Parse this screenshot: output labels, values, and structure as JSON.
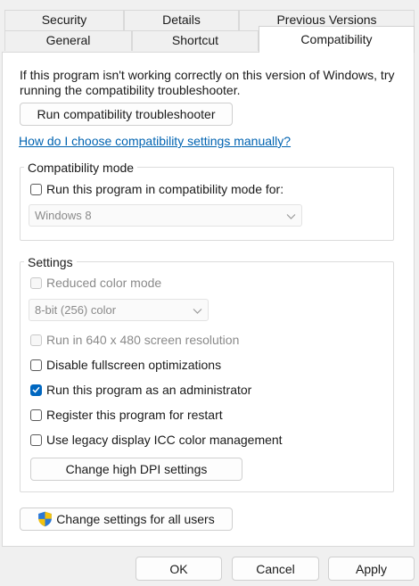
{
  "tabs": {
    "row1": [
      "Security",
      "Details",
      "Previous Versions"
    ],
    "row2": [
      "General",
      "Shortcut",
      "Compatibility"
    ],
    "active": "Compatibility"
  },
  "intro": {
    "line1": "If this program isn't working correctly on this version of Windows, try",
    "line2": "running the compatibility troubleshooter."
  },
  "troubleshooter_button": "Run compatibility troubleshooter",
  "manual_link": "How do I choose compatibility settings manually?",
  "compat_mode": {
    "title": "Compatibility mode",
    "checkbox_label": "Run this program in compatibility mode for:",
    "checked": false,
    "selected_os": "Windows 8"
  },
  "settings": {
    "title": "Settings",
    "reduced_color": {
      "label": "Reduced color mode",
      "checked": false,
      "disabled": true
    },
    "color_depth": "8-bit (256) color",
    "res_640": {
      "label": "Run in 640 x 480 screen resolution",
      "checked": false,
      "disabled": true
    },
    "disable_fullscreen": {
      "label": "Disable fullscreen optimizations",
      "checked": false
    },
    "run_as_admin": {
      "label": "Run this program as an administrator",
      "checked": true
    },
    "register_restart": {
      "label": "Register this program for restart",
      "checked": false
    },
    "legacy_icc": {
      "label": "Use legacy display ICC color management",
      "checked": false
    },
    "dpi_button": "Change high DPI settings"
  },
  "all_users_button": "Change settings for all users",
  "footer": {
    "ok": "OK",
    "cancel": "Cancel",
    "apply": "Apply"
  },
  "colors": {
    "accent": "#0067c0",
    "link": "#0063b1",
    "disabled_text": "#8a8a8a"
  }
}
